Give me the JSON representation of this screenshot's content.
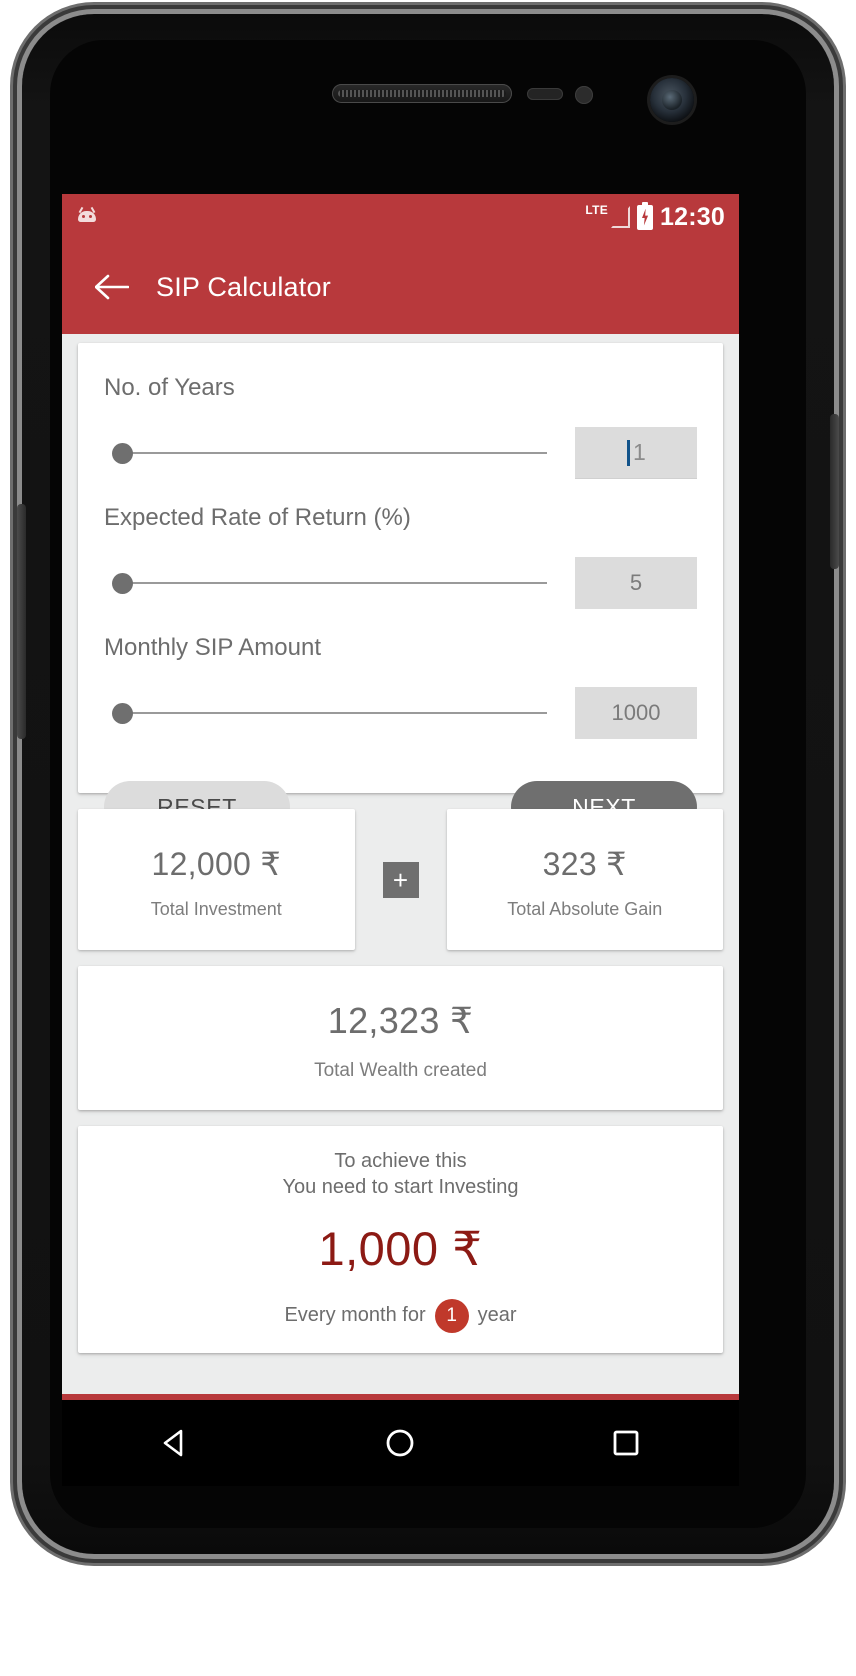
{
  "status_bar": {
    "notification_icon": "android-logo-icon",
    "network_label": "LTE",
    "signal_icon": "signal-bars-icon",
    "battery_icon": "battery-charging-icon",
    "time": "12:30"
  },
  "app_bar": {
    "back_icon": "back-arrow-icon",
    "title": "SIP Calculator"
  },
  "inputs": {
    "years": {
      "label": "No. of Years",
      "value": "1",
      "slider_position_pct": 0,
      "focused": true
    },
    "rate": {
      "label": "Expected Rate of Return (%)",
      "value": "5",
      "slider_position_pct": 0,
      "focused": false
    },
    "amount": {
      "label": "Monthly SIP Amount",
      "value": "1000",
      "slider_position_pct": 0,
      "focused": false
    }
  },
  "buttons": {
    "reset_label": "RESET",
    "next_label": "NEXT"
  },
  "summary": {
    "investment": {
      "amount": "12,000 ₹",
      "label": "Total Investment"
    },
    "operator": "+",
    "gain": {
      "amount": "323 ₹",
      "label": "Total Absolute Gain"
    }
  },
  "wealth": {
    "amount": "12,323 ₹",
    "label": "Total Wealth created"
  },
  "achieve": {
    "line1": "To achieve this",
    "line2": "You need to start Investing",
    "amount": "1,000 ₹",
    "footer_prefix": "Every month for",
    "badge_value": "1",
    "footer_suffix": "year"
  },
  "nav_bar": {
    "back": "nav-back-triangle-icon",
    "home": "nav-home-circle-icon",
    "recents": "nav-recents-square-icon"
  },
  "colors": {
    "brand_red": "#b8393c",
    "accent_dark_red": "#8c1a14",
    "badge_red": "#c0392b",
    "screen_bg": "#eceded",
    "card_bg": "#ffffff",
    "text_gray": "#6d6d6d",
    "input_bg": "#dcdcdc",
    "caret_blue": "#12538a",
    "button_dark": "#6f6f6f"
  }
}
